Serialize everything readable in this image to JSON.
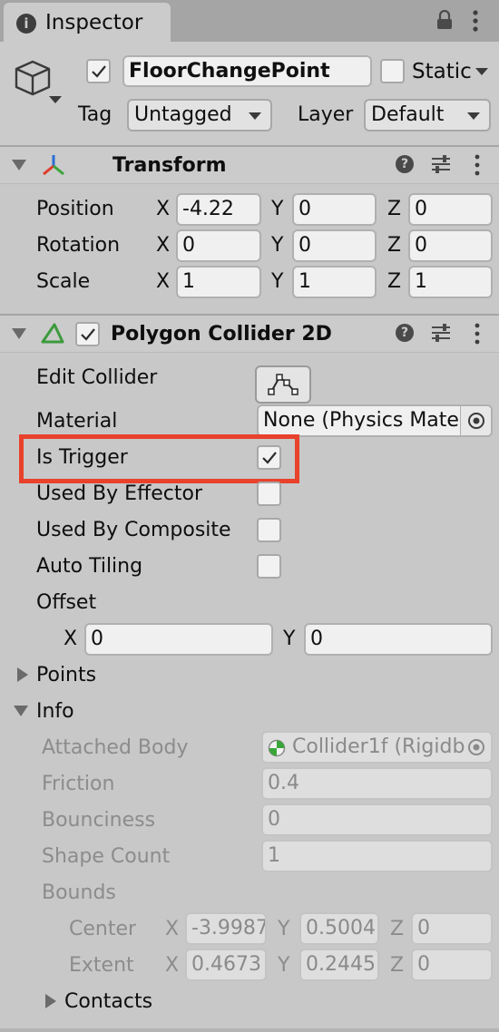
{
  "tab": {
    "title": "Inspector"
  },
  "object": {
    "name": "FloorChangePoint",
    "static_label": "Static",
    "tag_label": "Tag",
    "tag_value": "Untagged",
    "layer_label": "Layer",
    "layer_value": "Default"
  },
  "transform": {
    "title": "Transform",
    "rows": [
      {
        "label": "Position",
        "x": "-4.22",
        "y": "0",
        "z": "0"
      },
      {
        "label": "Rotation",
        "x": "0",
        "y": "0",
        "z": "0"
      },
      {
        "label": "Scale",
        "x": "1",
        "y": "1",
        "z": "1"
      }
    ],
    "axis_x": "X",
    "axis_y": "Y",
    "axis_z": "Z"
  },
  "collider": {
    "title": "Polygon Collider 2D",
    "edit_collider_label": "Edit Collider",
    "material_label": "Material",
    "material_value": "None (Physics Mate",
    "is_trigger_label": "Is Trigger",
    "is_trigger": true,
    "used_by_effector_label": "Used By Effector",
    "used_by_composite_label": "Used By Composite",
    "auto_tiling_label": "Auto Tiling",
    "offset_label": "Offset",
    "offset_x": "0",
    "offset_y": "0",
    "points_label": "Points",
    "info_label": "Info",
    "info": {
      "attached_body_label": "Attached Body",
      "attached_body_value": "Collider1f (Rigidb",
      "friction_label": "Friction",
      "friction_value": "0.4",
      "bounciness_label": "Bounciness",
      "bounciness_value": "0",
      "shape_count_label": "Shape Count",
      "shape_count_value": "1",
      "bounds_label": "Bounds",
      "center_label": "Center",
      "center_x": "-3.9987",
      "center_y": "0.5004",
      "center_z": "0",
      "extent_label": "Extent",
      "extent_x": "0.4673",
      "extent_y": "0.2445",
      "extent_z": "0",
      "contacts_label": "Contacts"
    }
  },
  "colors": {
    "highlight_box": "#e8412c",
    "transform_red": "#e03c2e",
    "transform_green": "#3aa63a",
    "transform_blue": "#2a6fd6",
    "collider_green": "#3c9a3c"
  }
}
